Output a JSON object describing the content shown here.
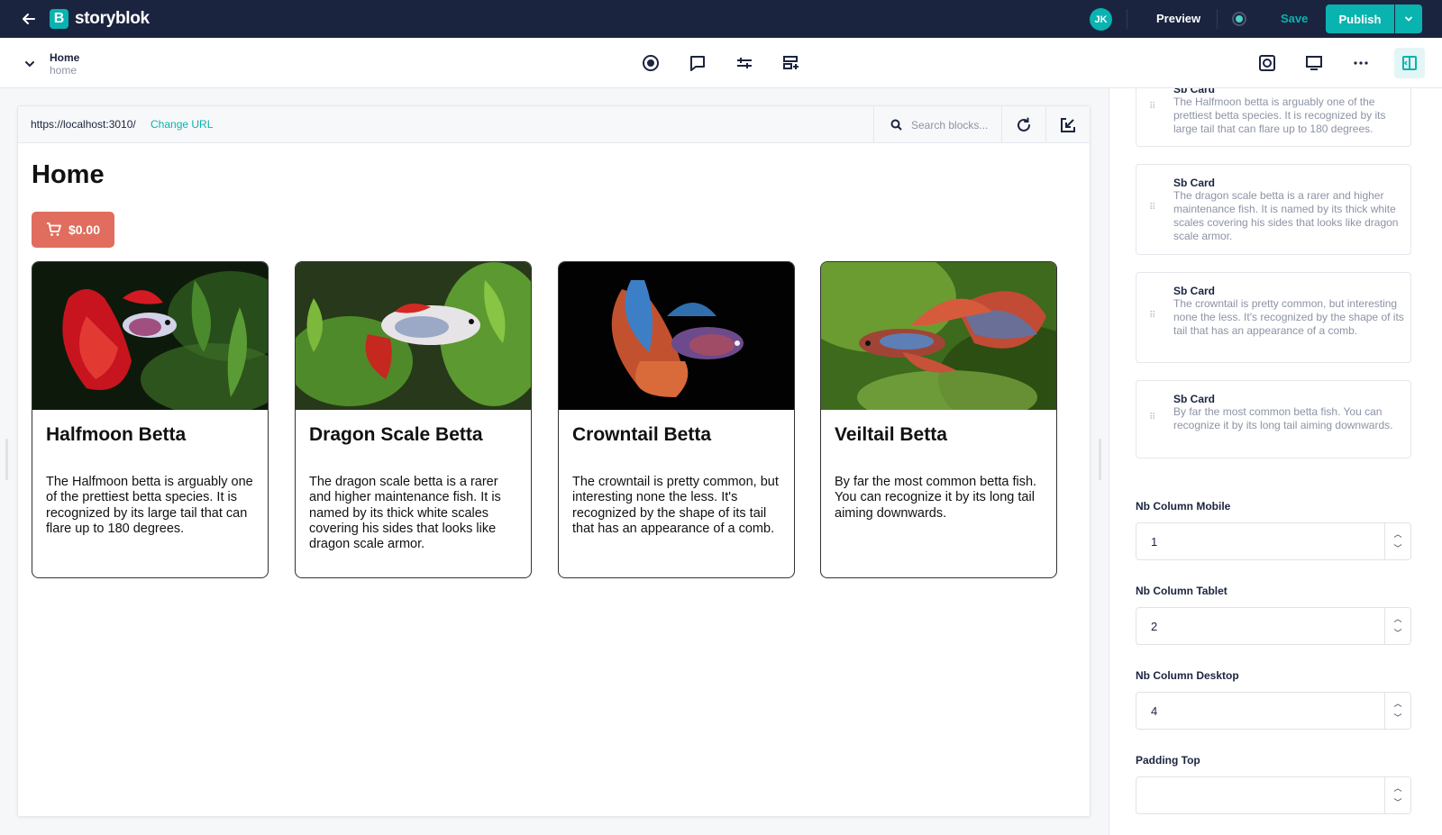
{
  "topbar": {
    "logo_text": "storyblok",
    "logo_mark": "B",
    "avatar_initials": "JK",
    "preview_label": "Preview",
    "save_label": "Save",
    "publish_label": "Publish"
  },
  "story": {
    "title": "Home",
    "slug": "home"
  },
  "preview": {
    "url": "https://localhost:3010/",
    "change_url_label": "Change URL",
    "search_placeholder": "Search blocks..."
  },
  "page": {
    "heading": "Home",
    "cart_total": "$0.00",
    "cards": [
      {
        "title": "Halfmoon Betta",
        "description": "The Halfmoon betta is arguably one of the prettiest betta species. It is recognized by its large tail that can flare up to 180 degrees.",
        "image": "halfmoon-betta-photo"
      },
      {
        "title": "Dragon Scale Betta",
        "description": "The dragon scale betta is a rarer and higher maintenance fish. It is named by its thick white scales covering his sides that looks like dragon scale armor.",
        "image": "dragon-scale-betta-photo"
      },
      {
        "title": "Crowntail Betta",
        "description": "The crowntail is pretty common, but interesting none the less. It's recognized by the shape of its tail that has an appearance of a comb.",
        "image": "crowntail-betta-photo"
      },
      {
        "title": "Veiltail Betta",
        "description": "By far the most common betta fish. You can recognize it by its long tail aiming downwards.",
        "image": "veiltail-betta-photo"
      }
    ]
  },
  "panel": {
    "blocks": [
      {
        "name": "Sb Card",
        "description": "The Halfmoon betta is arguably one of the prettiest betta species. It is recognized by its large tail that can flare up to 180 degrees."
      },
      {
        "name": "Sb Card",
        "description": "The dragon scale betta is a rarer and higher maintenance fish. It is named by its thick white scales covering his sides that looks like dragon scale armor."
      },
      {
        "name": "Sb Card",
        "description": "The crowntail is pretty common, but interesting none the less. It's recognized by the shape of its tail that has an appearance of a comb."
      },
      {
        "name": "Sb Card",
        "description": "By far the most common betta fish. You can recognize it by its long tail aiming downwards."
      }
    ],
    "fields": [
      {
        "label": "Nb Column Mobile",
        "value": "1"
      },
      {
        "label": "Nb Column Tablet",
        "value": "2"
      },
      {
        "label": "Nb Column Desktop",
        "value": "4"
      },
      {
        "label": "Padding Top",
        "value": ""
      }
    ]
  },
  "colors": {
    "topbar_bg": "#1b243f",
    "accent": "#09b3af",
    "cart_button": "#e06d5d"
  }
}
